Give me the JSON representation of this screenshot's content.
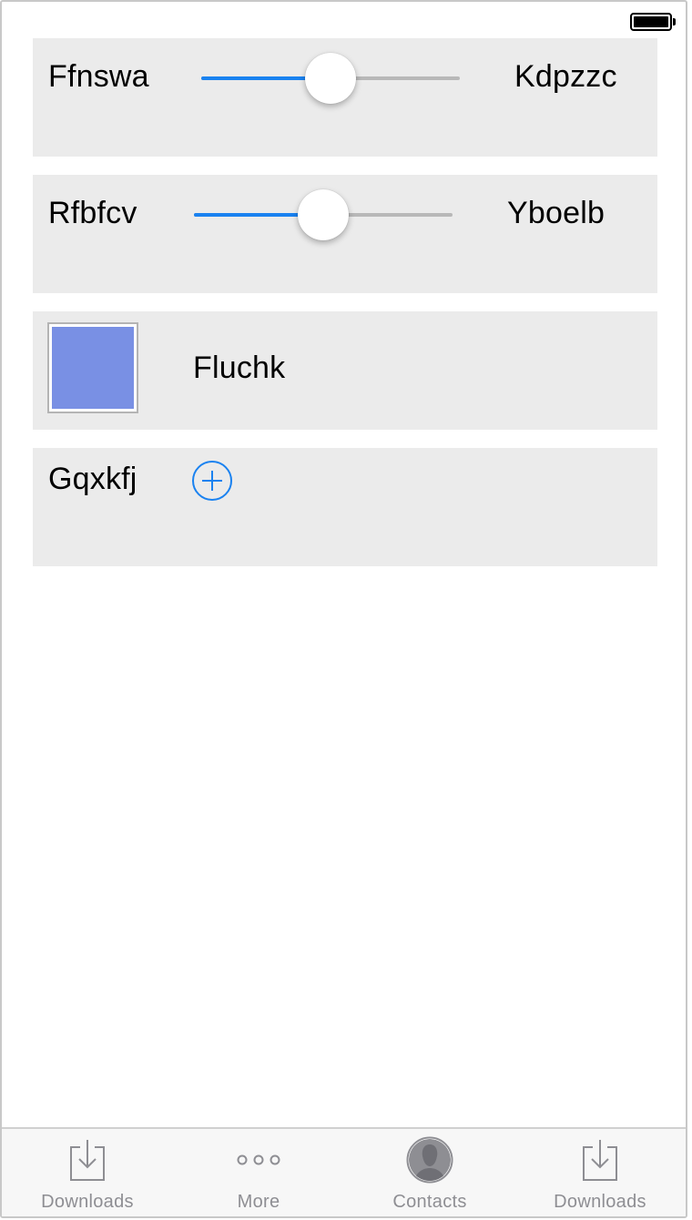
{
  "status_bar": {
    "battery_icon": "battery-full-icon"
  },
  "rows": {
    "slider1": {
      "left_label": "Ffnswa",
      "right_label": "Kdpzzc",
      "value": 0.5
    },
    "slider2": {
      "left_label": "Rfbfcv",
      "right_label": "Yboelb",
      "value": 0.5
    },
    "color_row": {
      "label": "Fluchk",
      "color": "#7990e4"
    },
    "add_row": {
      "label": "Gqxkfj",
      "icon": "add-circle-icon"
    }
  },
  "colors": {
    "accent": "#1a82f0",
    "panel_bg": "#ebebeb",
    "tab_inactive": "#8e8e93"
  },
  "tabbar": {
    "tabs": [
      {
        "label": "Downloads",
        "icon": "download-icon"
      },
      {
        "label": "More",
        "icon": "more-icon"
      },
      {
        "label": "Contacts",
        "icon": "contact-icon"
      },
      {
        "label": "Downloads",
        "icon": "download-icon"
      }
    ]
  }
}
